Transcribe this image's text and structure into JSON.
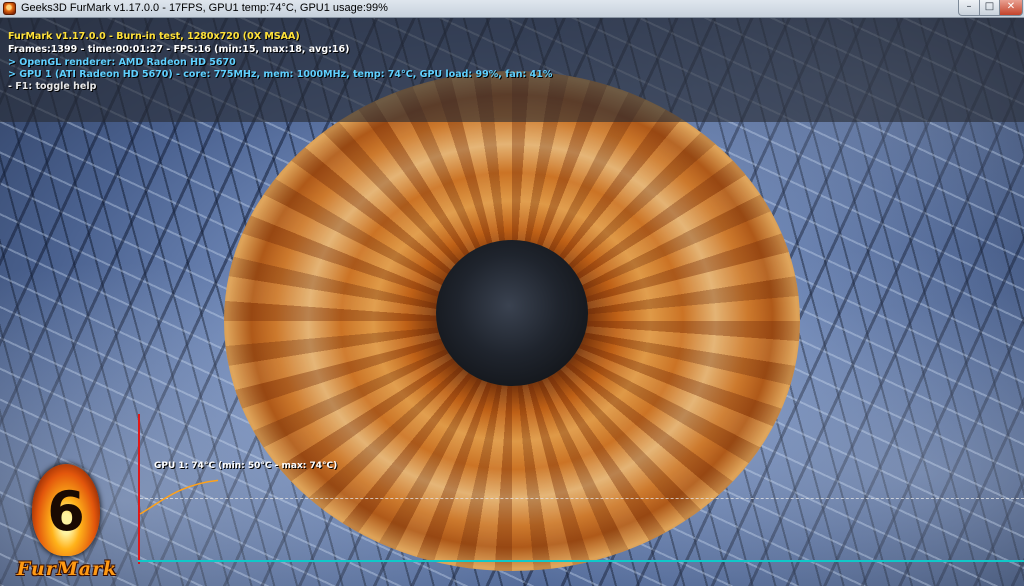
{
  "window": {
    "title": "Geeks3D FurMark v1.17.0.0 - 17FPS, GPU1 temp:74°C, GPU1 usage:99%",
    "app_icon": "furmark-flame-icon",
    "controls": {
      "minimize_glyph": "–",
      "maximize_glyph": "□",
      "close_glyph": "✕"
    }
  },
  "hud": {
    "title": "FurMark v1.17.0.0 - Burn-in test, 1280x720 (0X MSAA)",
    "stats": "Frames:1399 - time:00:01:27 - FPS:16 (min:15, max:18, avg:16)",
    "renderer": "> OpenGL renderer: AMD Radeon HD 5670",
    "gpu": "> GPU 1 (ATI Radeon HD 5670) - core: 775MHz, mem: 1000MHz, temp: 74°C, GPU load: 99%, fan: 41%",
    "help": "- F1: toggle help",
    "colors": {
      "title": "#ffe23a",
      "stats": "#ffffff",
      "info": "#5fd0ff"
    }
  },
  "temperature_graph": {
    "label": "GPU 1: 74°C (min: 50°C - max: 74°C)",
    "current_c": 74,
    "min_c": 50,
    "max_c": 74,
    "curve_color": "#ffa21a",
    "axis_y_color": "#e01818",
    "axis_x_color": "#10c8c8"
  },
  "logo": {
    "digit": "6",
    "text": "FurMark"
  }
}
